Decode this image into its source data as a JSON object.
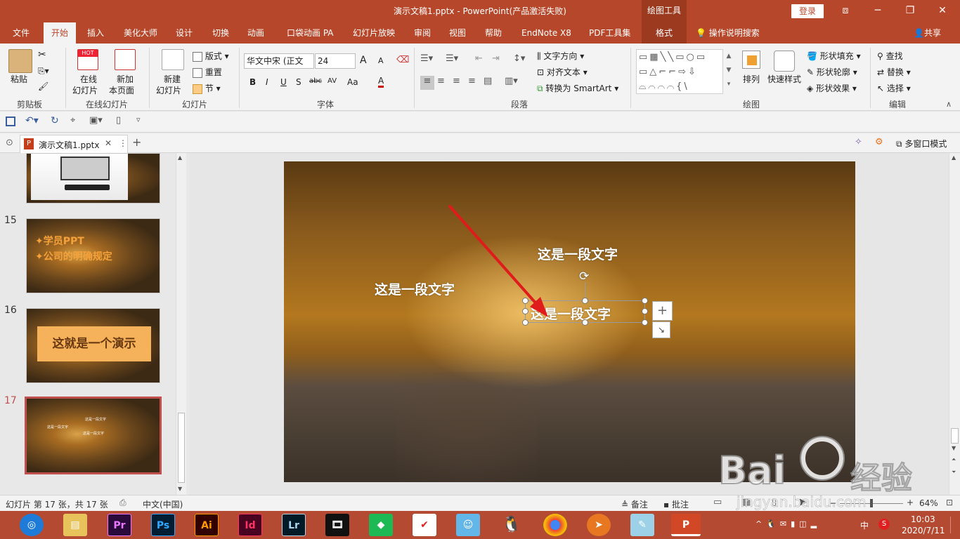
{
  "window": {
    "title": "演示文稿1.pptx  -  PowerPoint(产品激活失败)",
    "context_tool": "绘图工具",
    "login": "登录",
    "controls": {
      "restore_small": "⧈",
      "minimize": "─",
      "maximize": "❐",
      "close": "✕"
    }
  },
  "tabs": [
    "文件",
    "开始",
    "插入",
    "美化大师",
    "设计",
    "切换",
    "动画",
    "口袋动画 PA",
    "幻灯片放映",
    "审阅",
    "视图",
    "帮助",
    "EndNote X8",
    "PDF工具集",
    "格式"
  ],
  "active_tab": "开始",
  "tell_me": "操作说明搜索",
  "share": "共享",
  "ribbon": {
    "clipboard": {
      "paste": "粘贴",
      "label": "剪贴板"
    },
    "online": {
      "btn1a": "在线",
      "btn1b": "幻灯片",
      "btn2a": "新加",
      "btn2b": "本页面",
      "label": "在线幻灯片",
      "hot": "HOT"
    },
    "slides": {
      "new_a": "新建",
      "new_b": "幻灯片",
      "layout": "版式",
      "reset": "重置",
      "section": "节",
      "label": "幻灯片"
    },
    "font": {
      "name": "华文中宋 (正文",
      "size": "24",
      "bold": "B",
      "italic": "I",
      "underline": "U",
      "shadow": "S",
      "strike": "abc",
      "spacing": "AV",
      "case": "Aa",
      "color": "A",
      "grow": "A",
      "shrink": "A",
      "label": "字体"
    },
    "paragraph": {
      "text_dir": "文字方向",
      "align_text": "对齐文本",
      "smartart": "转换为 SmartArt",
      "label": "段落"
    },
    "drawing": {
      "arrange": "排列",
      "quick_styles": "快速样式",
      "fill": "形状填充",
      "outline": "形状轮廓",
      "effects": "形状效果",
      "label": "绘图"
    },
    "editing": {
      "find": "查找",
      "replace": "替换",
      "select": "选择",
      "label": "编辑"
    }
  },
  "doc_tab": {
    "name": "演示文稿1.pptx",
    "close": "✕",
    "more": "⋮",
    "add": "+"
  },
  "multi_window": "多窗口模式",
  "thumbnails": [
    {
      "num": "15",
      "lines": [
        "✦学员PPT",
        "✦公司的明确规定"
      ]
    },
    {
      "num": "16",
      "text": "这就是一个演示"
    },
    {
      "num": "17",
      "texts": [
        "这是一段文字",
        "这是一段文字",
        "这是一段文字"
      ]
    }
  ],
  "slide": {
    "text1": "这是一段文字",
    "text2": "这是一段文字",
    "text3": "这是一段文字"
  },
  "status": {
    "slide_info": "幻灯片 第 17 张，共 17 张",
    "language": "中文(中国)",
    "notes": "备注",
    "comments": "批注",
    "zoom": "64%"
  },
  "taskbar": {
    "apps": [
      "Pr",
      "Ps",
      "Ai",
      "Id",
      "Lr"
    ],
    "time": "10:03",
    "date": "2020/7/11",
    "ime": "中"
  },
  "watermark": {
    "brand": "Bai",
    "brand2": "经验",
    "url": "jingyan.baidu.com"
  },
  "colors": {
    "accent": "#b7472a",
    "selected_thumb": "#c0504d",
    "arrow": "#e01b1b"
  }
}
